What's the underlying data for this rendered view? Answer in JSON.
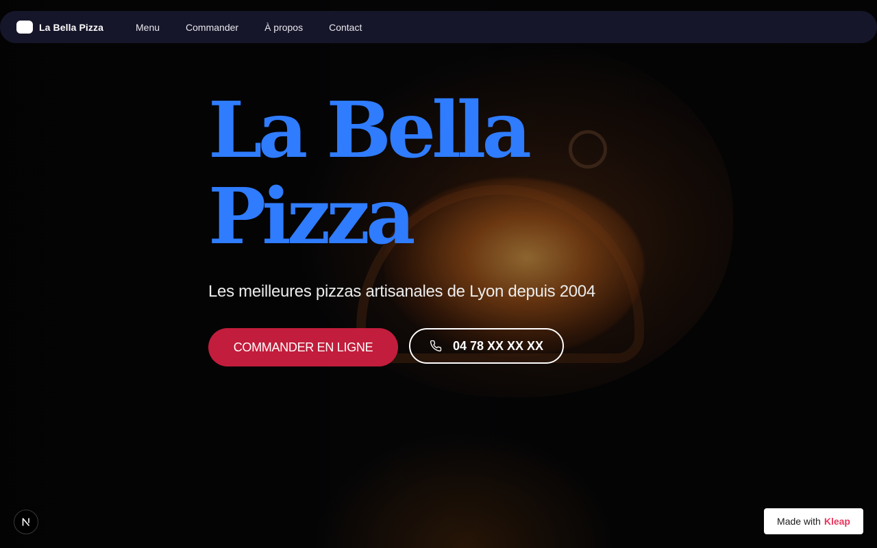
{
  "navbar": {
    "brand_name": "La Bella Pizza",
    "links": [
      {
        "label": "Menu"
      },
      {
        "label": "Commander"
      },
      {
        "label": "À propos"
      },
      {
        "label": "Contact"
      }
    ]
  },
  "hero": {
    "title_line1": "La Bella",
    "title_line2": "Pizza",
    "subtitle": "Les meilleures pizzas artisanales de Lyon depuis 2004",
    "order_button": "COMMANDER EN LIGNE",
    "phone_button": "04 78 XX XX XX",
    "phone_icon": "phone-icon"
  },
  "badge": {
    "letter": "N",
    "icon": "nextjs-icon"
  },
  "made_with": {
    "prefix": "Made with",
    "brand": "Kleap"
  },
  "colors": {
    "title_blue": "#2f7cff",
    "order_red": "#c21d3c",
    "nav_bg": "#16162a",
    "kleap_pink": "#e8365d"
  }
}
